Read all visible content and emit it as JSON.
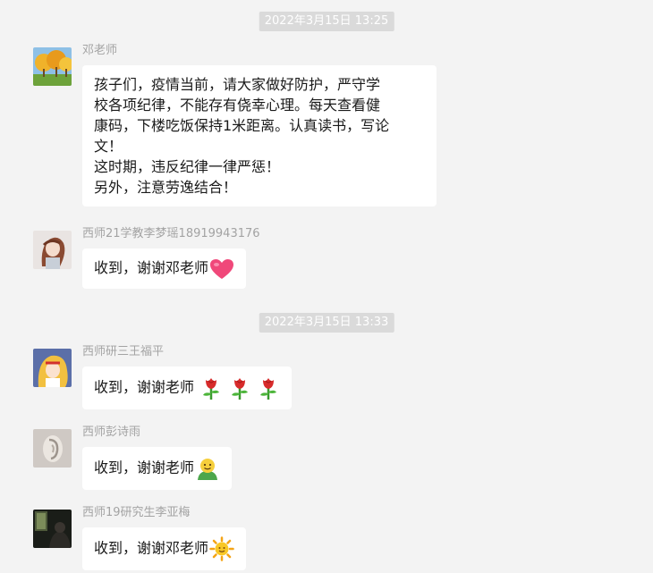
{
  "timestamps": [
    "2022年3月15日 13:25",
    "2022年3月15日 13:33"
  ],
  "messages": [
    {
      "sender": "邓老师",
      "avatar": "autumn-trees-avatar",
      "text": "孩子们，疫情当前，请大家做好防护，严守学\n校各项纪律，不能存有侥幸心理。每天查看健\n康码，下楼吃饭保持1米距离。认真读书，写论\n文！\n这时期，违反纪律一律严惩！\n另外，注意劳逸结合！",
      "emoji": []
    },
    {
      "sender": "西师21学教李梦瑶18919943176",
      "avatar": "anime-girl-avatar",
      "text": "收到，谢谢邓老师",
      "emoji": [
        "heart-icon"
      ]
    },
    {
      "sender": "西师研三王福平",
      "avatar": "sailor-venus-avatar",
      "text": "收到，谢谢老师",
      "emoji": [
        "rose-icon",
        "rose-icon",
        "rose-icon"
      ]
    },
    {
      "sender": "西师彭诗雨",
      "avatar": "ear-sculpture-avatar",
      "text": "收到，谢谢老师",
      "emoji": [
        "person-smile-icon"
      ]
    },
    {
      "sender": "西师19研究生李亚梅",
      "avatar": "dark-window-avatar",
      "text": "收到，谢谢邓老师",
      "emoji": [
        "sun-icon"
      ]
    }
  ],
  "colors": {
    "background": "#f3f3f3",
    "bubble": "#ffffff",
    "timestamp_bg": "#dadada",
    "sender_text": "#a3a3a3"
  }
}
